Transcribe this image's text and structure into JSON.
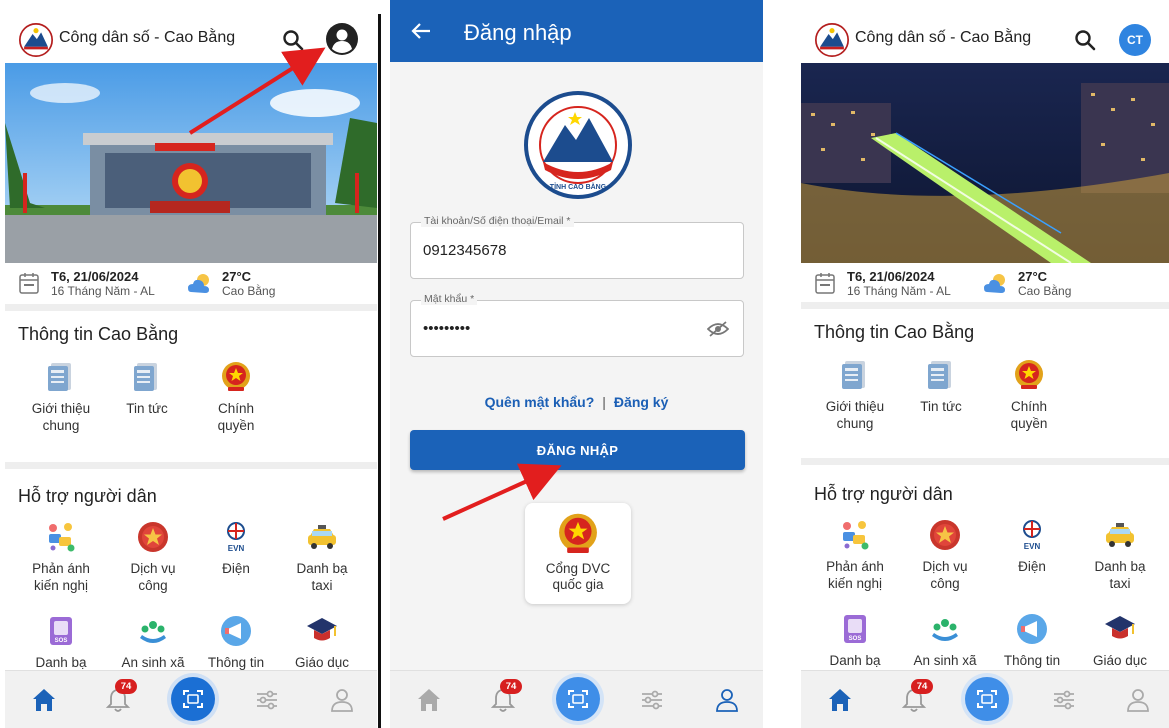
{
  "app": {
    "title": "Công dân số - Cao Bằng",
    "avatar_initials": "CT"
  },
  "date_weather": {
    "date": "T6, 21/06/2024",
    "lunar_date": "16 Tháng Năm - AL",
    "temperature": "27°C",
    "location": "Cao Bằng"
  },
  "info_section": {
    "title": "Thông tin Cao Bằng",
    "items": [
      {
        "label_l1": "Giới thiệu",
        "label_l2": "chung",
        "icon": "newspaper-icon"
      },
      {
        "label_l1": "Tin tức",
        "label_l2": "",
        "icon": "newspaper-icon"
      },
      {
        "label_l1": "Chính",
        "label_l2": "quyền",
        "icon": "national-emblem-icon"
      }
    ]
  },
  "support_section": {
    "title": "Hỗ trợ người dân",
    "items": [
      {
        "label_l1": "Phản ánh",
        "label_l2": "kiến nghị",
        "icon": "feedback-icon"
      },
      {
        "label_l1": "Dịch vụ",
        "label_l2": "công",
        "icon": "public-service-icon"
      },
      {
        "label_l1": "Điện",
        "label_l2": "",
        "icon": "evn-electricity-icon"
      },
      {
        "label_l1": "Danh bạ",
        "label_l2": "taxi",
        "icon": "taxi-icon"
      },
      {
        "label_l1": "Danh bạ",
        "label_l2": "",
        "icon": "phonebook-icon"
      },
      {
        "label_l1": "An sinh xã",
        "label_l2": "",
        "icon": "social-welfare-icon"
      },
      {
        "label_l1": "Thông tin",
        "label_l2": "",
        "icon": "megaphone-icon"
      },
      {
        "label_l1": "Giáo dục",
        "label_l2": "",
        "icon": "graduation-cap-icon"
      }
    ]
  },
  "bottom_nav": {
    "notification_count": "74",
    "items": [
      "home-icon",
      "bell-icon",
      "scan-icon",
      "sliders-icon",
      "person-icon"
    ]
  },
  "login": {
    "title": "Đăng nhập",
    "seal_text": "TỈNH CAO BẰNG",
    "account_label": "Tài khoản/Số điện thoại/Email *",
    "account_value": "0912345678",
    "password_label": "Mật khẩu *",
    "password_value": "•••••••••",
    "forgot_password": "Quên mật khẩu?",
    "separator": "|",
    "register": "Đăng ký",
    "login_button": "ĐĂNG NHẬP",
    "dvc_l1": "Cổng DVC",
    "dvc_l2": "quốc gia"
  },
  "colors": {
    "primary_blue": "#1b62b8",
    "annotation_red": "#e21e1e",
    "badge_red": "#d71f1f"
  }
}
